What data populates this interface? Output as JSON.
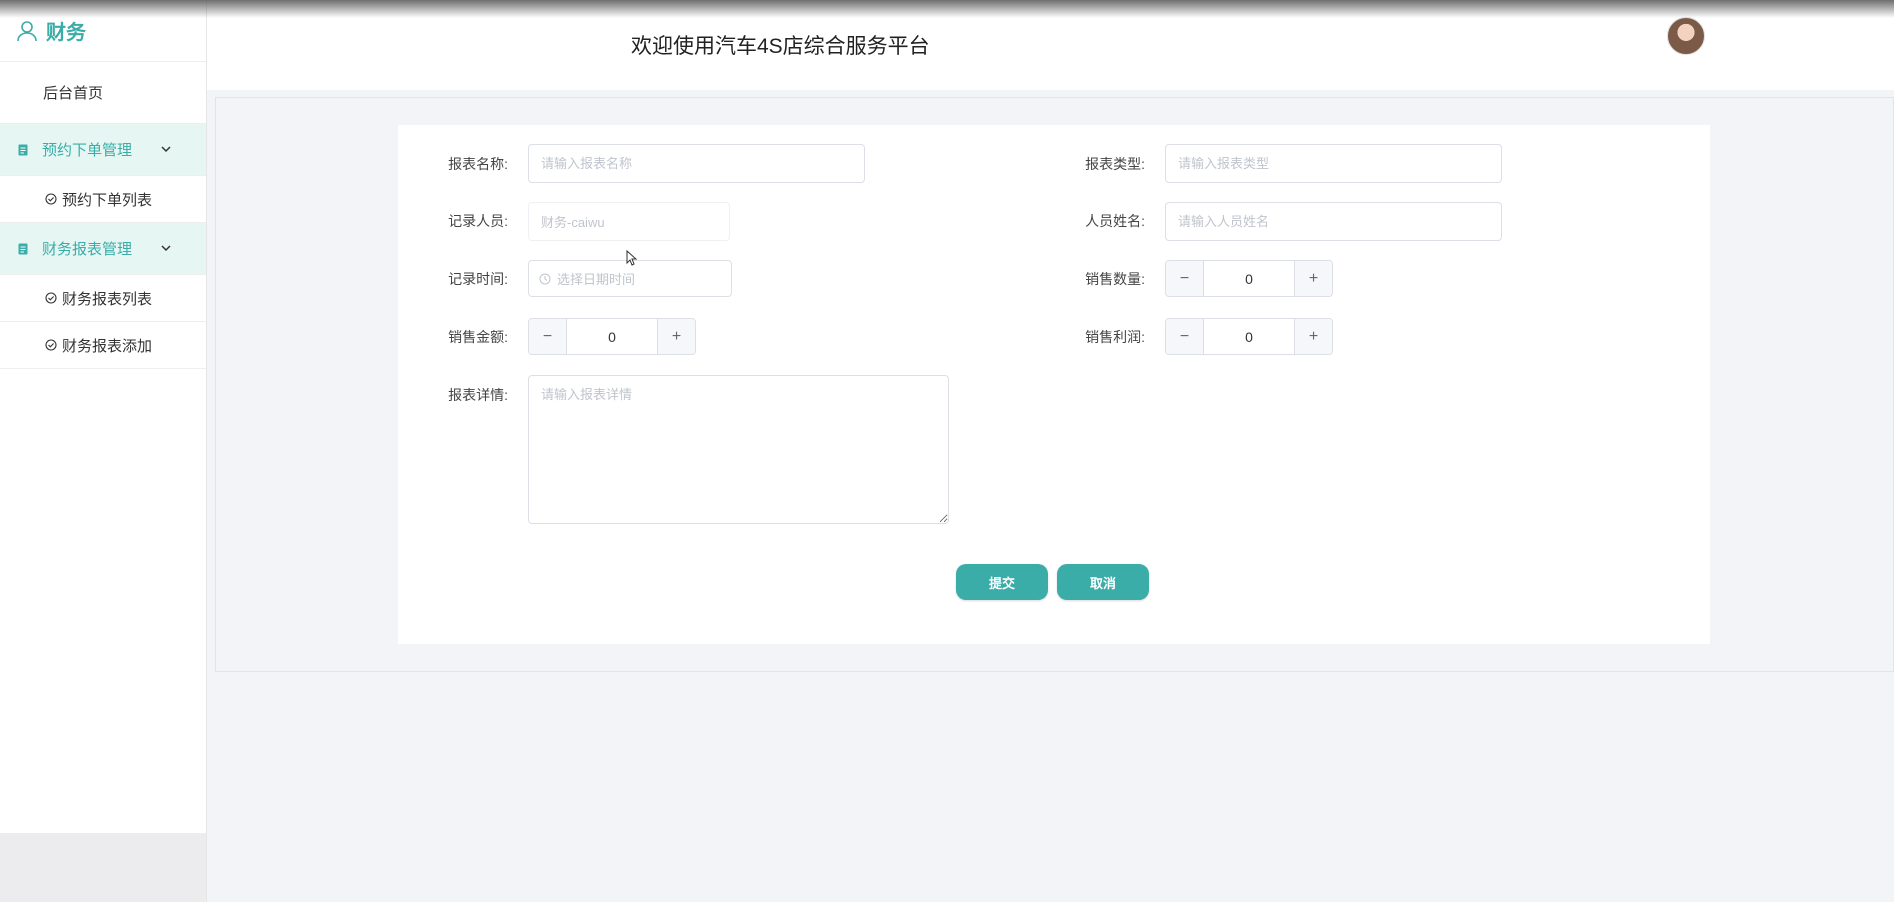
{
  "sidebar": {
    "brand": "财务",
    "home": "后台首页",
    "groups": [
      {
        "label": "预约下单管理",
        "items": [
          "预约下单列表"
        ]
      },
      {
        "label": "财务报表管理",
        "items": [
          "财务报表列表",
          "财务报表添加"
        ]
      }
    ]
  },
  "header": {
    "title": "欢迎使用汽车4S店综合服务平台"
  },
  "form": {
    "report_name": {
      "label": "报表名称:",
      "placeholder": "请输入报表名称"
    },
    "report_type": {
      "label": "报表类型:",
      "placeholder": "请输入报表类型"
    },
    "recorder": {
      "label": "记录人员:",
      "value": "财务-caiwu"
    },
    "person_name": {
      "label": "人员姓名:",
      "placeholder": "请输入人员姓名"
    },
    "record_time": {
      "label": "记录时间:",
      "placeholder": "选择日期时间"
    },
    "sales_qty": {
      "label": "销售数量:",
      "value": "0"
    },
    "sales_amount": {
      "label": "销售金额:",
      "value": "0"
    },
    "sales_profit": {
      "label": "销售利润:",
      "value": "0"
    },
    "details": {
      "label": "报表详情:",
      "placeholder": "请输入报表详情"
    },
    "submit": "提交",
    "cancel": "取消"
  },
  "colors": {
    "accent": "#3aada8",
    "group_bg": "#e6f6f3"
  },
  "icons": {
    "brand": "user-icon",
    "group": "document-icon",
    "expand": "chevron-down-icon",
    "sub_item": "check-circle-icon",
    "date": "clock-icon"
  }
}
